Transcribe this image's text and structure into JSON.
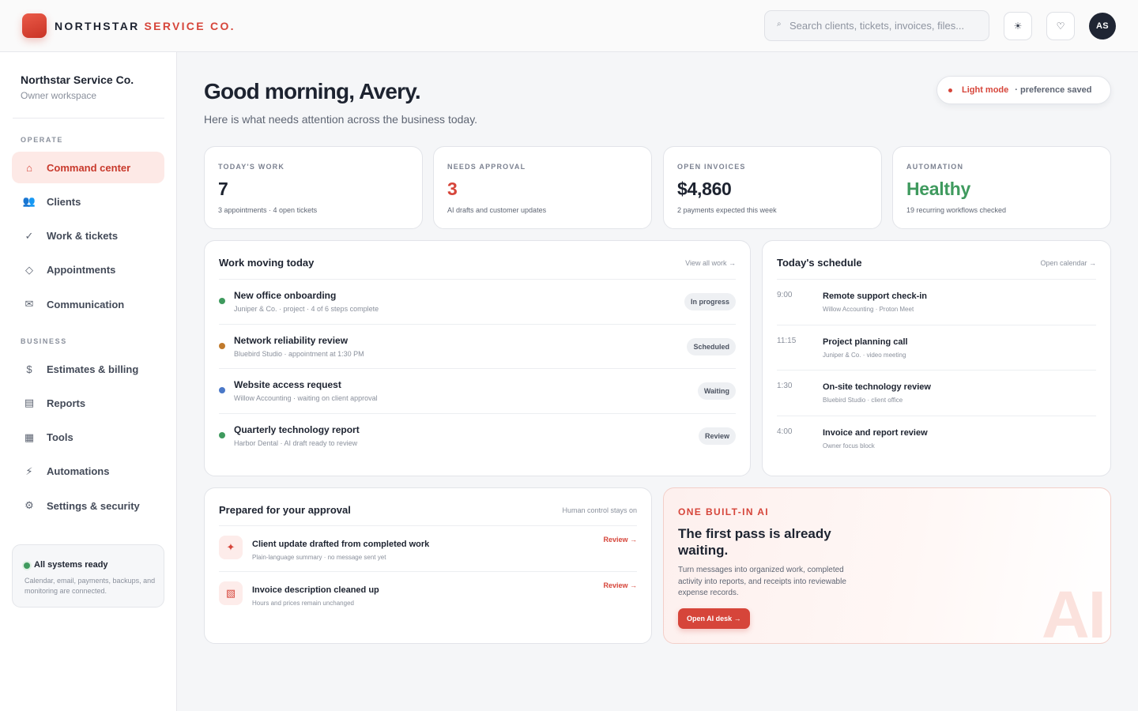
{
  "brand": {
    "name": "NORTHSTAR",
    "accent": "SERVICE CO."
  },
  "search": {
    "placeholder": "Search clients, tickets, invoices, files..."
  },
  "header": {
    "theme_icon": "sun-icon",
    "favorites_icon": "heart-icon",
    "avatar_initials": "AS"
  },
  "sidebar": {
    "workspace_name": "Northstar Service Co.",
    "workspace_sub": "Owner workspace",
    "section_operate": "OPERATE",
    "section_business": "BUSINESS",
    "operate_items": [
      {
        "label": "Command center",
        "icon": "home-icon",
        "glyph": "⌂",
        "active": true
      },
      {
        "label": "Clients",
        "icon": "users-icon",
        "glyph": "👥"
      },
      {
        "label": "Work & tickets",
        "icon": "check-icon",
        "glyph": "✓"
      },
      {
        "label": "Appointments",
        "icon": "diamond-icon",
        "glyph": "◇"
      },
      {
        "label": "Communication",
        "icon": "mail-icon",
        "glyph": "✉"
      }
    ],
    "business_items": [
      {
        "label": "Estimates & billing",
        "icon": "dollar-icon",
        "glyph": "$"
      },
      {
        "label": "Reports",
        "icon": "report-icon",
        "glyph": "▤"
      },
      {
        "label": "Tools",
        "icon": "grid-icon",
        "glyph": "▦"
      },
      {
        "label": "Automations",
        "icon": "lightning-icon",
        "glyph": "⚡"
      },
      {
        "label": "Settings & security",
        "icon": "gear-icon",
        "glyph": "⚙"
      }
    ],
    "status": {
      "title": "All systems ready",
      "desc": "Calendar, email, payments, backups, and monitoring are connected."
    }
  },
  "main": {
    "greeting": "Good morning, Avery.",
    "subtitle": "Here is what needs attention across the business today.",
    "mode": {
      "label": "Light mode",
      "note": "· preference saved"
    }
  },
  "stats": [
    {
      "label": "TODAY'S WORK",
      "value": "7",
      "note": "3 appointments · 4 open tickets",
      "color": "#1d2330"
    },
    {
      "label": "NEEDS APPROVAL",
      "value": "3",
      "note": "AI drafts and customer updates",
      "color": "#d6453a"
    },
    {
      "label": "OPEN INVOICES",
      "value": "$4,860",
      "note": "2 payments expected this week",
      "color": "#1d2330"
    },
    {
      "label": "AUTOMATION",
      "value": "Healthy",
      "note": "19 recurring workflows checked",
      "color": "#3f9a5e"
    }
  ],
  "work": {
    "title": "Work moving today",
    "link": "View all work →",
    "items": [
      {
        "title": "New office onboarding",
        "meta": "Juniper & Co. · project · 4 of 6 steps complete",
        "status": "In progress",
        "dot_color": "#3f9a5e"
      },
      {
        "title": "Network reliability review",
        "meta": "Bluebird Studio · appointment at 1:30 PM",
        "status": "Scheduled",
        "dot_color": "#c07a2c"
      },
      {
        "title": "Website access request",
        "meta": "Willow Accounting · waiting on client approval",
        "status": "Waiting",
        "dot_color": "#4a78c8"
      },
      {
        "title": "Quarterly technology report",
        "meta": "Harbor Dental · AI draft ready to review",
        "status": "Review",
        "dot_color": "#3f9a5e"
      }
    ]
  },
  "schedule": {
    "title": "Today's schedule",
    "link": "Open calendar →",
    "items": [
      {
        "time": "9:00",
        "title": "Remote support check-in",
        "meta": "Willow Accounting · Proton Meet"
      },
      {
        "time": "11:15",
        "title": "Project planning call",
        "meta": "Juniper & Co. · video meeting"
      },
      {
        "time": "1:30",
        "title": "On-site technology review",
        "meta": "Bluebird Studio · client office"
      },
      {
        "time": "4:00",
        "title": "Invoice and report review",
        "meta": "Owner focus block"
      }
    ]
  },
  "approval": {
    "title": "Prepared for your approval",
    "note": "Human control stays on",
    "items": [
      {
        "title": "Client update drafted from completed work",
        "meta": "Plain-language summary · no message sent yet",
        "action": "Review →",
        "icon": "sparkle-icon",
        "glyph": "✦"
      },
      {
        "title": "Invoice description cleaned up",
        "meta": "Hours and prices remain unchanged",
        "action": "Review →",
        "icon": "invoice-icon",
        "glyph": "▧"
      }
    ]
  },
  "ai": {
    "eyebrow": "ONE BUILT-IN AI",
    "heading": "The first pass is already waiting.",
    "desc": "Turn messages into organized work, completed activity into reports, and receipts into reviewable expense records.",
    "button": "Open AI desk →",
    "watermark": "AI"
  },
  "colors": {
    "accent": "#d6453a",
    "success": "#3f9a5e",
    "text": "#1d2330"
  }
}
